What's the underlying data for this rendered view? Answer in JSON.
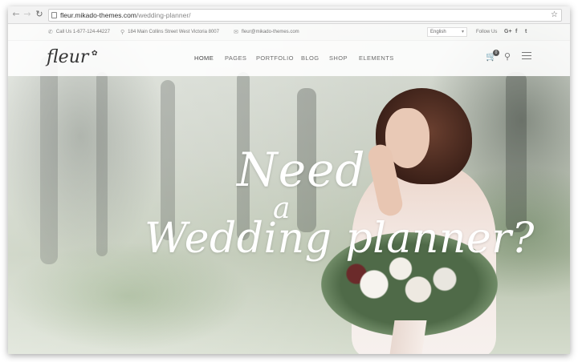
{
  "browser": {
    "back_icon": "arrow-left-icon",
    "forward_icon": "arrow-right-icon",
    "reload_icon": "reload-icon",
    "url_host": "fleur.mikado-themes.com",
    "url_path": "/wedding-planner/",
    "bookmark_icon": "star-icon"
  },
  "infobar": {
    "phone": "Call Us 1-677-124-44227",
    "address": "184 Main Collins Street West Victoria 8007",
    "email": "fleur@mikado-themes.com",
    "language": "English",
    "follow_label": "Follow Us",
    "social": [
      "G+",
      "f",
      "t"
    ]
  },
  "header": {
    "logo": "fleur",
    "nav": [
      "HOME",
      "PAGES",
      "PORTFOLIO",
      "BLOG",
      "SHOP",
      "ELEMENTS"
    ],
    "active_nav": "HOME",
    "cart_count": "0"
  },
  "hero": {
    "line1": "Need",
    "line2": "a",
    "line3": "Wedding planner?"
  },
  "colors": {
    "accent": "#333333",
    "nav_text": "#6d6d6d",
    "headline": "#ffffff"
  }
}
